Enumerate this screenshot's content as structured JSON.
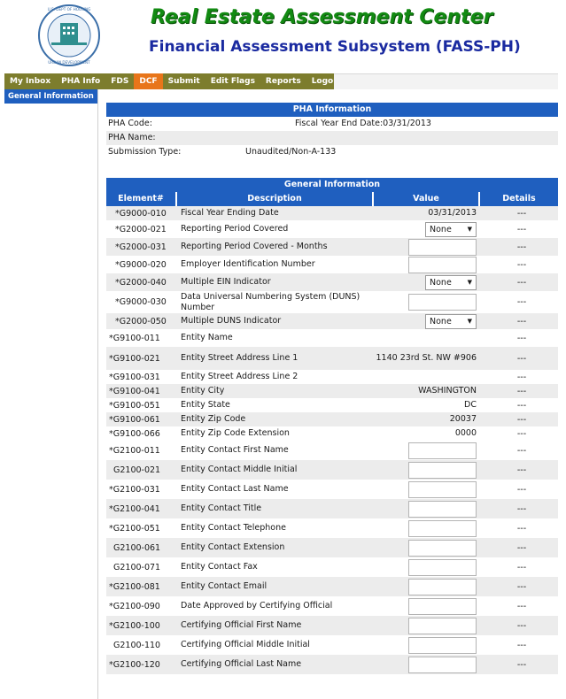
{
  "header": {
    "title": "Real Estate Assessment Center",
    "subtitle": "Financial Assessment Subsystem (FASS-PH)",
    "seal_text": "U.S. DEPARTMENT OF HOUSING AND URBAN DEVELOPMENT"
  },
  "nav": {
    "items": [
      "My Inbox",
      "PHA Info",
      "FDS",
      "DCF",
      "Submit",
      "Edit Flags",
      "Reports",
      "Logout"
    ],
    "active": "DCF"
  },
  "sidebar": {
    "active_label": "General Information"
  },
  "pha_info": {
    "title": "PHA Information",
    "pha_code_label": "PHA Code:",
    "pha_code_value": "",
    "fiscal_year_end_label": "Fiscal Year End Date:03/31/2013",
    "pha_name_label": "PHA Name:",
    "pha_name_value": "",
    "submission_type_label": "Submission Type:",
    "submission_type_value": "Unaudited/Non-A-133"
  },
  "general_info": {
    "title": "General Information",
    "columns": [
      "Element#",
      "Description",
      "Value",
      "Details"
    ],
    "rows": [
      {
        "element": "*G9000-010",
        "description": "Fiscal Year Ending Date",
        "value": "03/31/2013",
        "control": "text",
        "details": "---"
      },
      {
        "element": "*G2000-021",
        "description": "Reporting Period Covered",
        "value": "None",
        "control": "select",
        "details": "---"
      },
      {
        "element": "*G2000-031",
        "description": "Reporting Period Covered - Months",
        "value": "",
        "control": "input",
        "details": "---"
      },
      {
        "element": "*G9000-020",
        "description": "Employer Identification Number",
        "value": "",
        "control": "input",
        "details": "---"
      },
      {
        "element": "*G2000-040",
        "description": "Multiple EIN Indicator",
        "value": "None",
        "control": "select",
        "details": "---"
      },
      {
        "element": "*G9000-030",
        "description": "Data Universal Numbering System (DUNS) Number",
        "value": "",
        "control": "input",
        "details": "---"
      },
      {
        "element": "*G2000-050",
        "description": "Multiple DUNS Indicator",
        "value": "None",
        "control": "select",
        "details": "---"
      },
      {
        "element": "*G9100-011",
        "description": "Entity Name",
        "value": "",
        "control": "text",
        "details": "---"
      },
      {
        "element": "*G9100-021",
        "description": "Entity Street Address Line 1",
        "value": "1140 23rd St. NW #906",
        "control": "text",
        "details": "---"
      },
      {
        "element": "*G9100-031",
        "description": "Entity Street Address Line 2",
        "value": "",
        "control": "text",
        "details": "---"
      },
      {
        "element": "*G9100-041",
        "description": "Entity City",
        "value": "WASHINGTON",
        "control": "text",
        "details": "---"
      },
      {
        "element": "*G9100-051",
        "description": "Entity State",
        "value": "DC",
        "control": "text",
        "details": "---"
      },
      {
        "element": "*G9100-061",
        "description": "Entity Zip Code",
        "value": "20037",
        "control": "text",
        "details": "---"
      },
      {
        "element": "*G9100-066",
        "description": "Entity Zip Code Extension",
        "value": "0000",
        "control": "text",
        "details": "---"
      },
      {
        "element": "*G2100-011",
        "description": "Entity Contact First Name",
        "value": "",
        "control": "input",
        "details": "---"
      },
      {
        "element": "G2100-021",
        "description": "Entity Contact Middle Initial",
        "value": "",
        "control": "input",
        "details": "---"
      },
      {
        "element": "*G2100-031",
        "description": "Entity Contact Last Name",
        "value": "",
        "control": "input",
        "details": "---"
      },
      {
        "element": "*G2100-041",
        "description": "Entity Contact Title",
        "value": "",
        "control": "input",
        "details": "---"
      },
      {
        "element": "*G2100-051",
        "description": "Entity Contact Telephone",
        "value": "",
        "control": "input",
        "details": "---"
      },
      {
        "element": "G2100-061",
        "description": "Entity Contact Extension",
        "value": "",
        "control": "input",
        "details": "---"
      },
      {
        "element": "G2100-071",
        "description": "Entity Contact Fax",
        "value": "",
        "control": "input",
        "details": "---"
      },
      {
        "element": "*G2100-081",
        "description": "Entity Contact Email",
        "value": "",
        "control": "input",
        "details": "---"
      },
      {
        "element": "*G2100-090",
        "description": "Date Approved by Certifying Official",
        "value": "",
        "control": "input",
        "details": "---"
      },
      {
        "element": "*G2100-100",
        "description": "Certifying Official First Name",
        "value": "",
        "control": "input",
        "details": "---"
      },
      {
        "element": "G2100-110",
        "description": "Certifying Official Middle Initial",
        "value": "",
        "control": "input",
        "details": "---"
      },
      {
        "element": "*G2100-120",
        "description": "Certifying Official Last Name",
        "value": "",
        "control": "input",
        "details": "---"
      }
    ]
  },
  "colors": {
    "title_green": "#128a12",
    "subtitle_blue": "#1a2aa0",
    "nav_olive": "#7d7d2d",
    "nav_active": "#e8751a",
    "header_blue": "#1f5fbf"
  }
}
